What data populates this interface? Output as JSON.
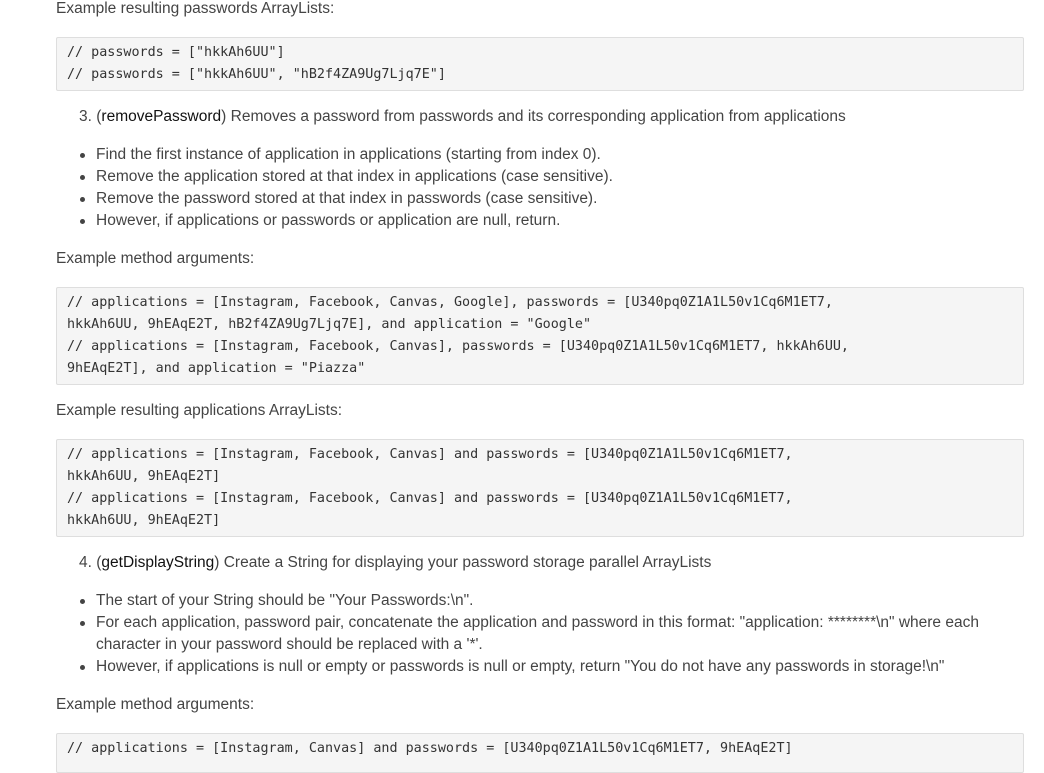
{
  "section_passwords_result": {
    "heading": "Example resulting passwords ArrayLists:",
    "code": [
      "// passwords = [\"hkkAh6UU\"]",
      "// passwords = [\"hkkAh6UU\", \"hB2f4ZA9Ug7Ljq7E\"]"
    ]
  },
  "step3": {
    "number": "3.",
    "method": "removePassword",
    "description": "Removes a password from passwords and its corresponding application from applications",
    "bullets": [
      "Find the first instance of application in applications (starting from index 0).",
      "Remove the application stored at that index in applications (case sensitive).",
      "Remove the password stored at that index in passwords (case sensitive).",
      "However, if applications or passwords or application are null, return."
    ],
    "args_heading": "Example method arguments:",
    "args_code": [
      "// applications = [Instagram, Facebook, Canvas, Google], passwords = [U340pq0Z1A1L50v1Cq6M1ET7,",
      "hkkAh6UU, 9hEAqE2T, hB2f4ZA9Ug7Ljq7E], and application = \"Google\"",
      "// applications = [Instagram, Facebook, Canvas], passwords = [U340pq0Z1A1L50v1Cq6M1ET7, hkkAh6UU,",
      "9hEAqE2T], and application = \"Piazza\""
    ],
    "result_heading": "Example resulting applications ArrayLists:",
    "result_code": [
      "// applications = [Instagram, Facebook, Canvas] and passwords = [U340pq0Z1A1L50v1Cq6M1ET7,",
      "hkkAh6UU, 9hEAqE2T]",
      "// applications = [Instagram, Facebook, Canvas] and passwords = [U340pq0Z1A1L50v1Cq6M1ET7,",
      "hkkAh6UU, 9hEAqE2T]"
    ]
  },
  "step4": {
    "number": "4.",
    "method": "getDisplayString",
    "description": "Create a String for displaying your password storage parallel ArrayLists",
    "bullets": [
      "The start of your String should be \"Your Passwords:\\n\".",
      "For each application, password pair, concatenate the application and password in this format: \"application: ********\\n\" where each",
      "character in your password should be replaced with a '*'.",
      "However, if applications is null or empty or passwords is null or empty, return \"You do not have any passwords in storage!\\n\""
    ],
    "args_heading": "Example method arguments:",
    "args_code": [
      "// applications = [Instagram, Canvas] and passwords = [U340pq0Z1A1L50v1Cq6M1ET7, 9hEAqE2T]"
    ]
  }
}
